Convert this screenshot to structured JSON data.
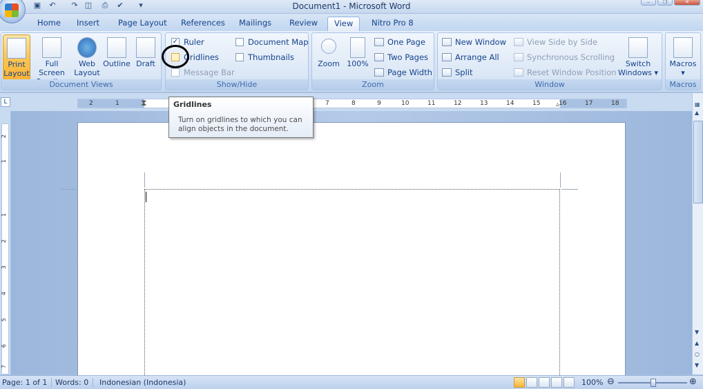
{
  "window": {
    "title": "Document1 - Microsoft Word"
  },
  "tabs": [
    "Home",
    "Insert",
    "Page Layout",
    "References",
    "Mailings",
    "Review",
    "View",
    "Nitro Pro 8"
  ],
  "active_tab": "View",
  "groups": {
    "document_views": {
      "label": "Document Views",
      "buttons": [
        {
          "label1": "Print",
          "label2": "Layout",
          "active": true
        },
        {
          "label1": "Full Screen",
          "label2": "Reading"
        },
        {
          "label1": "Web",
          "label2": "Layout"
        },
        {
          "label1": "Outline",
          "label2": ""
        },
        {
          "label1": "Draft",
          "label2": ""
        }
      ]
    },
    "show_hide": {
      "label": "Show/Hide",
      "ruler": "Ruler",
      "gridlines": "Gridlines",
      "message_bar": "Message Bar",
      "document_map": "Document Map",
      "thumbnails": "Thumbnails"
    },
    "zoom": {
      "label": "Zoom",
      "zoom": "Zoom",
      "hundred": "100%",
      "one_page": "One Page",
      "two_pages": "Two Pages",
      "page_width": "Page Width"
    },
    "window": {
      "label": "Window",
      "new_window": "New Window",
      "arrange_all": "Arrange All",
      "split": "Split",
      "view_side": "View Side by Side",
      "sync_scroll": "Synchronous Scrolling",
      "reset_pos": "Reset Window Position",
      "switch1": "Switch",
      "switch2": "Windows ▾"
    },
    "macros": {
      "label": "Macros",
      "button": "Macros"
    }
  },
  "tooltip": {
    "title": "Gridlines",
    "body1": "Turn on gridlines to which you can",
    "body2": "align objects in the document."
  },
  "ruler_ticks": [
    "2",
    "1",
    "1",
    "2",
    "7",
    "8",
    "9",
    "10",
    "11",
    "12",
    "13",
    "14",
    "15",
    "16",
    "17",
    "18"
  ],
  "vruler_ticks": [
    "2",
    "1",
    "1",
    "2",
    "3",
    "4",
    "5",
    "6",
    "7"
  ],
  "status": {
    "page": "Page: 1 of 1",
    "words": "Words: 0",
    "language": "Indonesian (Indonesia)",
    "zoom": "100%"
  },
  "colors": {
    "accent": "#15428b",
    "active": "#f9b234"
  }
}
